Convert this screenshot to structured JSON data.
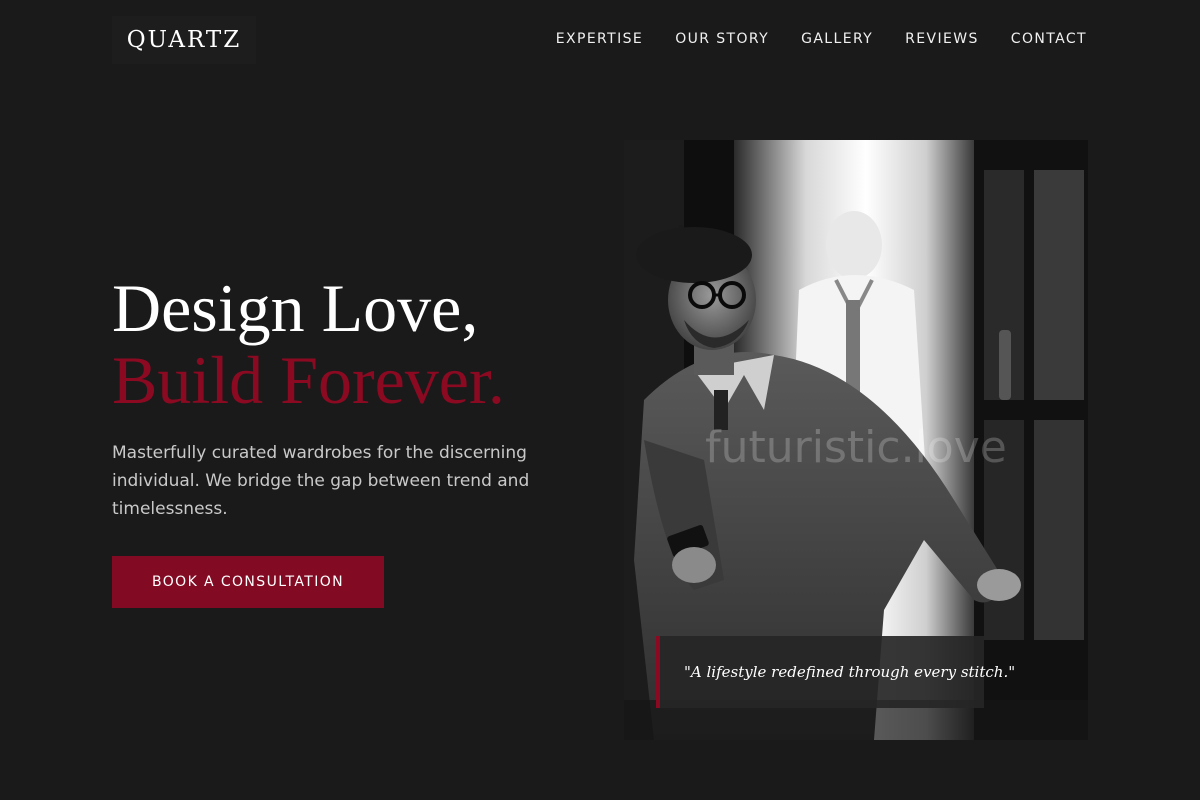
{
  "brand": {
    "name": "QUARTZ"
  },
  "nav": {
    "items": [
      {
        "label": "EXPERTISE"
      },
      {
        "label": "OUR STORY"
      },
      {
        "label": "GALLERY"
      },
      {
        "label": "REVIEWS"
      },
      {
        "label": "CONTACT"
      }
    ]
  },
  "hero": {
    "headline_line1": "Design Love,",
    "headline_line2": "Build Forever.",
    "subtext": "Masterfully curated wardrobes for the discerning individual. We bridge the gap between trend and timelessness.",
    "cta_label": "BOOK A CONSULTATION"
  },
  "image": {
    "watermark": "futuristic.love",
    "quote": "\"A lifestyle redefined through every stitch.\""
  },
  "colors": {
    "background": "#1a1a1b",
    "accent": "#8b0a22",
    "button": "#820b23",
    "text_primary": "#ffffff",
    "text_secondary": "#c9c9c9"
  },
  "icons": {
    "photo": "man-in-beret-at-shop-door-photo"
  }
}
